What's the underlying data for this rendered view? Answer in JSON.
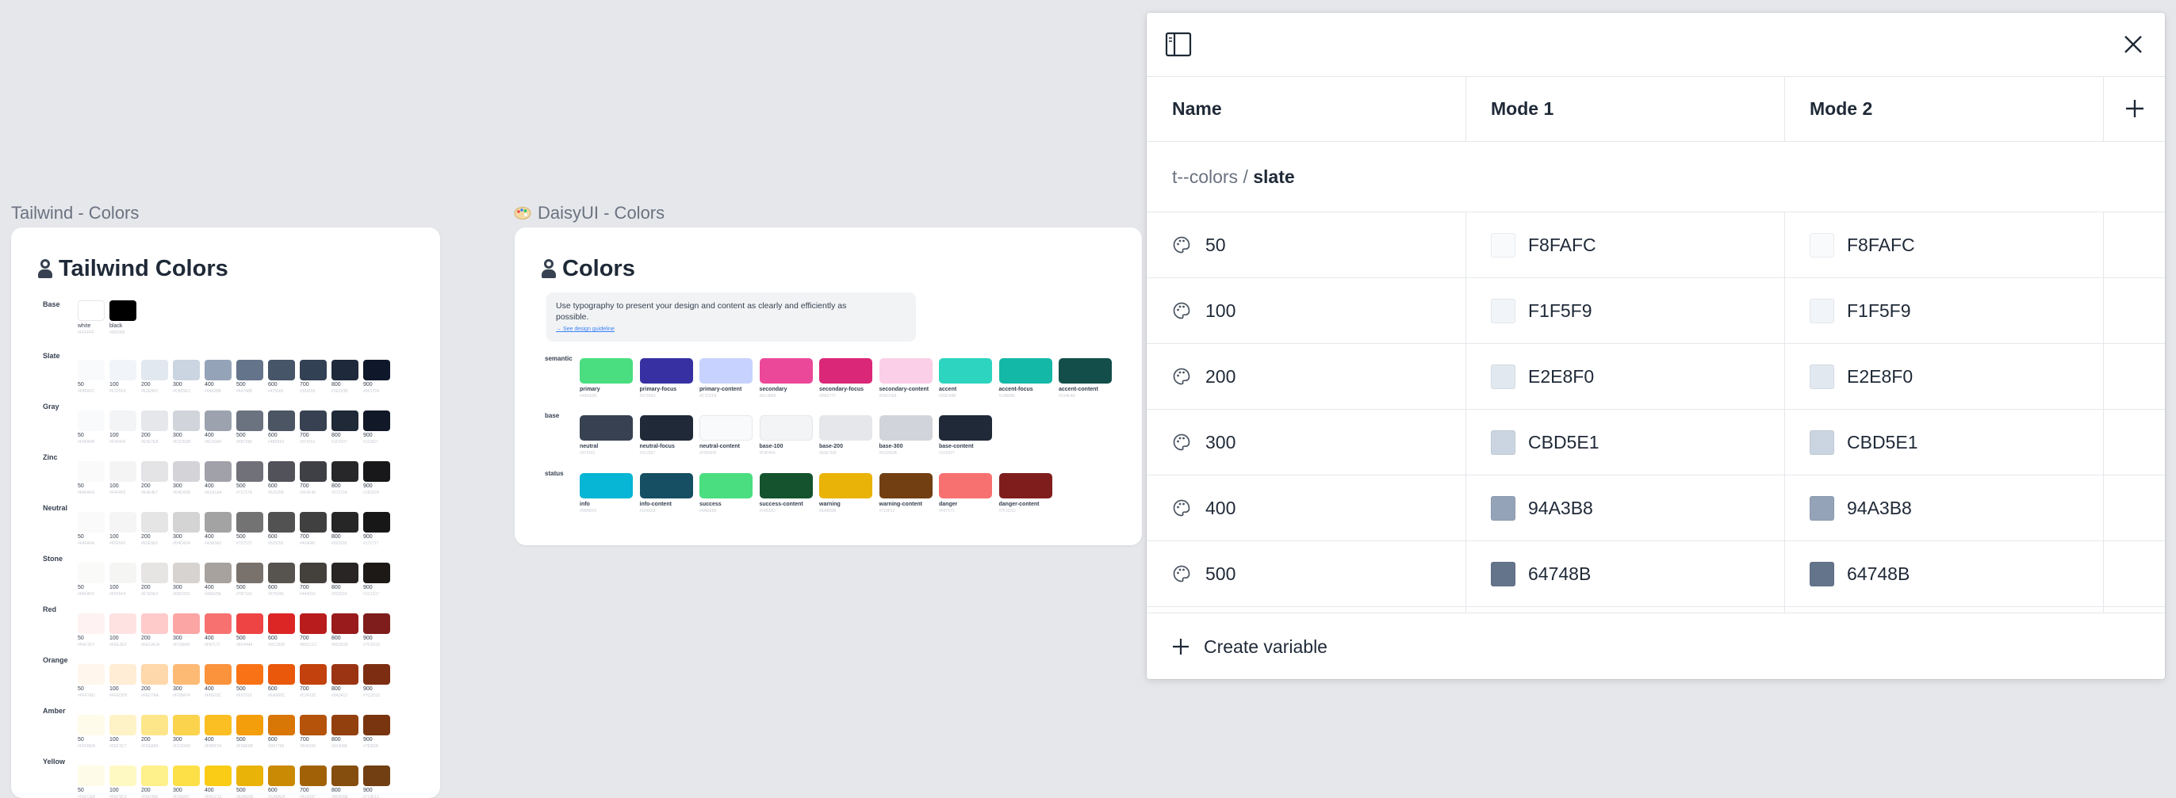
{
  "canvas": {
    "tailwind_frame_label": "Tailwind - Colors",
    "daisy_frame_label": "DaisyUI - Colors"
  },
  "tailwind": {
    "title": "Tailwind Colors",
    "base": {
      "label": "Base",
      "swatches": [
        {
          "name": "white",
          "hex": "#FFFFFF",
          "color": "#FFFFFF"
        },
        {
          "name": "black",
          "hex": "#000000",
          "color": "#000000"
        }
      ]
    },
    "steps": [
      "50",
      "100",
      "200",
      "300",
      "400",
      "500",
      "600",
      "700",
      "800",
      "900"
    ],
    "families": [
      {
        "label": "Slate",
        "colors": [
          "#F8FAFC",
          "#F1F5F9",
          "#E2E8F0",
          "#CBD5E1",
          "#94A3B8",
          "#64748B",
          "#475569",
          "#334155",
          "#1E293B",
          "#0F172A"
        ]
      },
      {
        "label": "Gray",
        "colors": [
          "#F9FAFB",
          "#F3F4F6",
          "#E5E7EB",
          "#D1D5DB",
          "#9CA3AF",
          "#6B7280",
          "#4B5563",
          "#374151",
          "#1F2937",
          "#111827"
        ]
      },
      {
        "label": "Zinc",
        "colors": [
          "#FAFAFA",
          "#F4F4F5",
          "#E4E4E7",
          "#D4D4D8",
          "#A1A1AA",
          "#71717A",
          "#52525B",
          "#3F3F46",
          "#27272A",
          "#18181B"
        ]
      },
      {
        "label": "Neutral",
        "colors": [
          "#FAFAFA",
          "#F5F5F5",
          "#E5E5E5",
          "#D4D4D4",
          "#A3A3A3",
          "#737373",
          "#525252",
          "#404040",
          "#262626",
          "#171717"
        ]
      },
      {
        "label": "Stone",
        "colors": [
          "#FAFAF9",
          "#F5F5F4",
          "#E7E5E4",
          "#D6D3D1",
          "#A8A29E",
          "#78716C",
          "#57534E",
          "#44403C",
          "#292524",
          "#1C1917"
        ]
      },
      {
        "label": "Red",
        "colors": [
          "#FEF2F2",
          "#FEE2E2",
          "#FECACA",
          "#FCA5A5",
          "#F87171",
          "#EF4444",
          "#DC2626",
          "#B91C1C",
          "#991B1B",
          "#7F1D1D"
        ]
      },
      {
        "label": "Orange",
        "colors": [
          "#FFF7ED",
          "#FFEDD5",
          "#FED7AA",
          "#FDBA74",
          "#FB923C",
          "#F97316",
          "#EA580C",
          "#C2410C",
          "#9A3412",
          "#7C2D12"
        ]
      },
      {
        "label": "Amber",
        "colors": [
          "#FFFBEB",
          "#FEF3C7",
          "#FDE68A",
          "#FCD34D",
          "#FBBF24",
          "#F59E0B",
          "#D97706",
          "#B45309",
          "#92400E",
          "#78350F"
        ]
      },
      {
        "label": "Yellow",
        "colors": [
          "#FEFCE8",
          "#FEF9C3",
          "#FEF08A",
          "#FDE047",
          "#FACC15",
          "#EAB308",
          "#CA8A04",
          "#A16207",
          "#854D0E",
          "#713F12"
        ]
      }
    ]
  },
  "daisy": {
    "title": "Colors",
    "info_text": "Use typography to present your design and content as clearly and efficiently as possible.",
    "info_link": "→ See design guideline",
    "groups": [
      {
        "label": "semantic",
        "items": [
          {
            "name": "primary",
            "color": "#4ADE80"
          },
          {
            "name": "primary-focus",
            "color": "#3730A3"
          },
          {
            "name": "primary-content",
            "color": "#C7D2FE"
          },
          {
            "name": "secondary",
            "color": "#EC4899"
          },
          {
            "name": "secondary-focus",
            "color": "#DB2777"
          },
          {
            "name": "secondary-content",
            "color": "#FBCFE8"
          },
          {
            "name": "accent",
            "color": "#2DD4BF"
          },
          {
            "name": "accent-focus",
            "color": "#14B8A6"
          },
          {
            "name": "accent-content",
            "color": "#134E4A"
          }
        ]
      },
      {
        "label": "base",
        "items": [
          {
            "name": "neutral",
            "color": "#374151"
          },
          {
            "name": "neutral-focus",
            "color": "#1F2937"
          },
          {
            "name": "neutral-content",
            "color": "#F9FAFB"
          },
          {
            "name": "base-100",
            "color": "#F3F4F6"
          },
          {
            "name": "base-200",
            "color": "#E5E7EB"
          },
          {
            "name": "base-300",
            "color": "#D1D5DB"
          },
          {
            "name": "base-content",
            "color": "#1F2937"
          }
        ]
      },
      {
        "label": "status",
        "items": [
          {
            "name": "info",
            "color": "#06B6D4"
          },
          {
            "name": "info-content",
            "color": "#164E63"
          },
          {
            "name": "success",
            "color": "#4ADE80"
          },
          {
            "name": "success-content",
            "color": "#14532D"
          },
          {
            "name": "warning",
            "color": "#EAB308"
          },
          {
            "name": "warning-content",
            "color": "#713F12"
          },
          {
            "name": "danger",
            "color": "#F87171"
          },
          {
            "name": "danger-content",
            "color": "#7F1D1D"
          }
        ]
      }
    ]
  },
  "panel": {
    "columns": {
      "name": "Name",
      "mode1": "Mode 1",
      "mode2": "Mode 2"
    },
    "breadcrumb": {
      "path": "t--colors / ",
      "leaf": "slate"
    },
    "variables": [
      {
        "name": "50",
        "mode1": "F8FAFC",
        "mode2": "F8FAFC",
        "color": "#F8FAFC"
      },
      {
        "name": "100",
        "mode1": "F1F5F9",
        "mode2": "F1F5F9",
        "color": "#F1F5F9"
      },
      {
        "name": "200",
        "mode1": "E2E8F0",
        "mode2": "E2E8F0",
        "color": "#E2E8F0"
      },
      {
        "name": "300",
        "mode1": "CBD5E1",
        "mode2": "CBD5E1",
        "color": "#CBD5E1"
      },
      {
        "name": "400",
        "mode1": "94A3B8",
        "mode2": "94A3B8",
        "color": "#94A3B8"
      },
      {
        "name": "500",
        "mode1": "64748B",
        "mode2": "64748B",
        "color": "#64748B"
      }
    ],
    "create_label": "Create variable",
    "icons": {
      "sidebar": "sidebar-toggle-icon",
      "close": "close-icon",
      "add": "plus-icon",
      "variable": "palette-icon"
    }
  }
}
